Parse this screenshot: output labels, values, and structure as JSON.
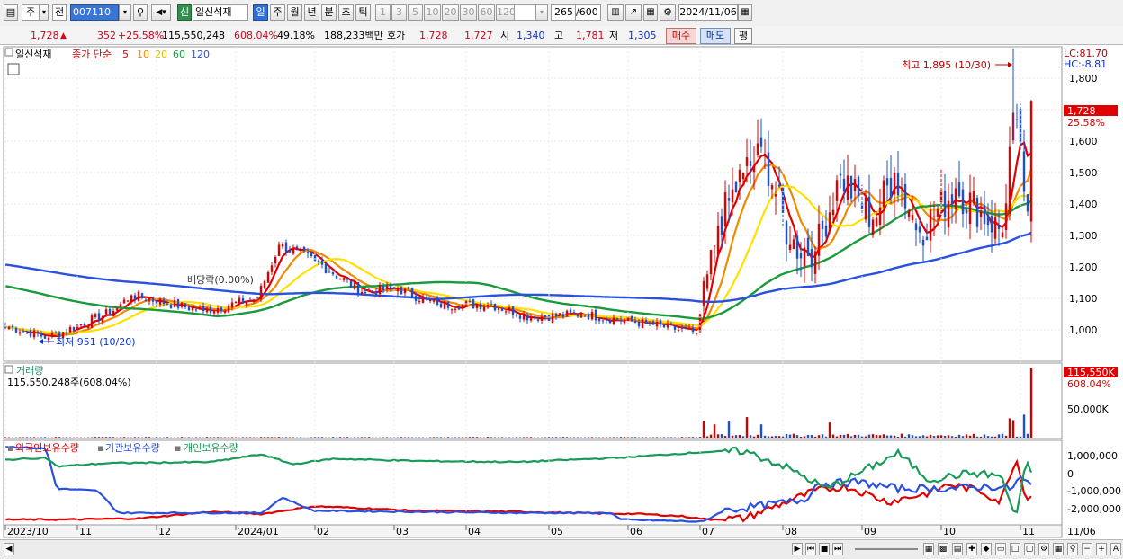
{
  "toolbar": {
    "market": "주",
    "prev_label": "전",
    "stock_code": "007110",
    "market_badge": "신",
    "stock_name": "일신석재",
    "periods": [
      "일",
      "주",
      "월",
      "년",
      "분",
      "초",
      "틱"
    ],
    "selected_period": "일",
    "intervals": [
      "1",
      "3",
      "5",
      "10",
      "20",
      "30",
      "60",
      "120"
    ],
    "count_value": "265",
    "count_total": "/600",
    "date": "2024/11/06"
  },
  "quote": {
    "price": "1,728",
    "change": "352",
    "change_pct": "+25.58%",
    "volume": "115,550,248",
    "volume_ratio": "608.04%",
    "turnover": "49.18%",
    "trade_amount": "188,233백만",
    "ask_label": "호가",
    "ask1": "1,728",
    "ask2": "1,727",
    "open_label": "시",
    "open": "1,340",
    "high_label": "고",
    "high": "1,781",
    "low_label": "저",
    "low": "1,305",
    "buy_label": "매수",
    "sell_label": "매도",
    "eval_label": "평"
  },
  "price_panel": {
    "name": "일신석재",
    "ma_title": "종가 단순",
    "ma_periods": [
      "5",
      "10",
      "20",
      "60",
      "120"
    ],
    "lc_label": "LC:81.70",
    "hc_label": "HC:-8.81",
    "price_tag": "1,728",
    "pct_tag": "25.58%",
    "max_label": "최고 1,895 (10/30)",
    "min_label": "최저 951 (10/20)",
    "dividend_label": "배당락(0.00%)"
  },
  "volume_panel": {
    "title": "거래량",
    "value_label": "115,550,248주(608.04%)",
    "tag_value": "115,550K",
    "tag_pct": "608.04%",
    "scale_label": "50,000K"
  },
  "holdings_panel": {
    "foreign_label": "외국인보유수량",
    "institution_label": "기관보유수량",
    "individual_label": "개인보유수량",
    "scale_labels": [
      "1,000,000",
      "0",
      "-1,000,000",
      "-2,000,000"
    ]
  },
  "x_axis": {
    "labels": [
      "2023/10",
      "11",
      "12",
      "2024/01",
      "02",
      "03",
      "04",
      "05",
      "06",
      "07",
      "08",
      "09",
      "10",
      "11",
      "11/06"
    ]
  },
  "chart_data": [
    {
      "type": "candlestick",
      "title": "일신석재",
      "ylim": [
        900,
        1900
      ],
      "yticks": [
        1000,
        1100,
        1200,
        1300,
        1400,
        1500,
        1600,
        1700,
        1800
      ],
      "series": [
        {
          "name": "5",
          "color": "#e00000"
        },
        {
          "name": "10",
          "color": "#f08a00"
        },
        {
          "name": "20",
          "color": "#ffe000"
        },
        {
          "name": "60",
          "color": "#1a9a3a"
        },
        {
          "name": "120",
          "color": "#2a50e0"
        }
      ],
      "anchors": [
        {
          "date": "2023/10/05",
          "close": 1010
        },
        {
          "date": "2023/10/20",
          "close": 975
        },
        {
          "date": "2023/11/15",
          "close": 1060
        },
        {
          "date": "2023/11/22",
          "close": 1110
        },
        {
          "date": "2023/12/20",
          "close": 1060
        },
        {
          "date": "2024/01/10",
          "close": 1100
        },
        {
          "date": "2024/01/18",
          "close": 1270
        },
        {
          "date": "2024/02/01",
          "close": 1220
        },
        {
          "date": "2024/02/20",
          "close": 1120
        },
        {
          "date": "2024/03/05",
          "close": 1130
        },
        {
          "date": "2024/03/20",
          "close": 1080
        },
        {
          "date": "2024/04/10",
          "close": 1080
        },
        {
          "date": "2024/04/25",
          "close": 1040
        },
        {
          "date": "2024/05/15",
          "close": 1050
        },
        {
          "date": "2024/06/10",
          "close": 1020
        },
        {
          "date": "2024/06/28",
          "close": 990
        },
        {
          "date": "2024/07/01",
          "close": 1050
        },
        {
          "date": "2024/07/08",
          "close": 1330
        },
        {
          "date": "2024/07/17",
          "close": 1500
        },
        {
          "date": "2024/07/25",
          "close": 1560
        },
        {
          "date": "2024/08/05",
          "close": 1270
        },
        {
          "date": "2024/08/14",
          "close": 1250
        },
        {
          "date": "2024/08/23",
          "close": 1490
        },
        {
          "date": "2024/09/05",
          "close": 1350
        },
        {
          "date": "2024/09/13",
          "close": 1500
        },
        {
          "date": "2024/09/24",
          "close": 1310
        },
        {
          "date": "2024/10/08",
          "close": 1450
        },
        {
          "date": "2024/10/25",
          "close": 1310
        },
        {
          "date": "2024/10/30",
          "close": 1690
        },
        {
          "date": "2024/11/05",
          "close": 1376
        },
        {
          "date": "2024/11/06",
          "close": 1728
        }
      ]
    },
    {
      "type": "bar",
      "title": "거래량",
      "unit": "K",
      "spikes": [
        {
          "date": "2024/07/02",
          "value": 28000
        },
        {
          "date": "2024/07/05",
          "value": 22000
        },
        {
          "date": "2024/07/11",
          "value": 28000
        },
        {
          "date": "2024/07/18",
          "value": 34000
        },
        {
          "date": "2024/07/24",
          "value": 22000
        },
        {
          "date": "2024/08/20",
          "value": 25000
        },
        {
          "date": "2024/10/29",
          "value": 32000
        },
        {
          "date": "2024/10/30",
          "value": 29000
        },
        {
          "date": "2024/11/04",
          "value": 38000
        },
        {
          "date": "2024/11/06",
          "value": 115550
        }
      ]
    },
    {
      "type": "line",
      "title": "보유수량",
      "ylim": [
        -2500000,
        1200000
      ],
      "series": [
        {
          "name": "외국인보유수량",
          "color": "#e00000"
        },
        {
          "name": "기관보유수량",
          "color": "#2a50e0"
        },
        {
          "name": "개인보유수량",
          "color": "#1a9a5a"
        }
      ]
    }
  ]
}
